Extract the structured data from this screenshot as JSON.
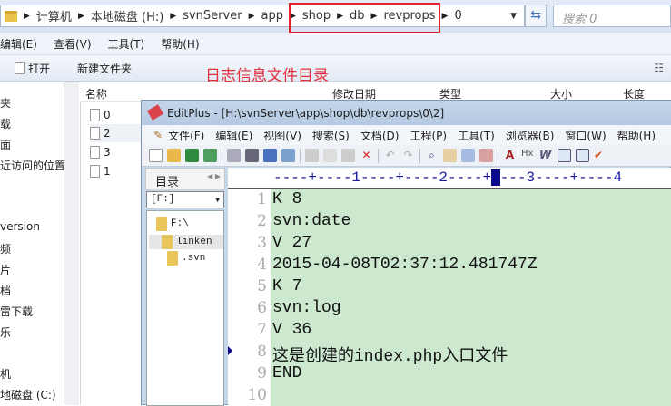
{
  "explorer": {
    "breadcrumb": [
      "计算机",
      "本地磁盘 (H:)",
      "svnServer",
      "app",
      "shop",
      "db",
      "revprops",
      "0"
    ],
    "search_placeholder": "搜索 0",
    "menu": [
      "编辑(E)",
      "查看(V)",
      "工具(T)",
      "帮助(H)"
    ],
    "commands": {
      "open": "打开",
      "new_folder": "新建文件夹"
    },
    "annotation": "日志信息文件目录",
    "annotation_color": "#e0303a",
    "nav_items": [
      "夹",
      "载",
      "面",
      "近访问的位置",
      "version",
      "频",
      "片",
      "档",
      "雷下载",
      "乐",
      "机",
      "地磁盘 (C:)"
    ],
    "columns": [
      "名称",
      "修改日期",
      "类型",
      "大小",
      "长度"
    ],
    "files": [
      "0",
      "2",
      "3",
      "1"
    ],
    "selected_file": "2"
  },
  "editplus": {
    "title": "EditPlus - [H:\\svnServer\\app\\shop\\db\\revprops\\0\\2]",
    "menu": [
      "文件(F)",
      "编辑(E)",
      "视图(V)",
      "搜索(S)",
      "文档(D)",
      "工程(P)",
      "工具(T)",
      "浏览器(B)",
      "窗口(W)",
      "帮助(H)"
    ],
    "dir_tab": "目录",
    "drive": "[F:]",
    "tree": [
      "F:\\",
      "linken",
      ".svn"
    ],
    "ruler": "----+----1----+----2----+",
    "ruler_tail": "---3----+----4",
    "lines": [
      "K 8",
      "svn:date",
      "V 27",
      "2015-04-08T02:37:12.481747Z",
      "K 7",
      "svn:log",
      "V 36",
      "这是创建的index.php入口文件",
      "END",
      ""
    ],
    "line_numbers": [
      "1",
      "2",
      "3",
      "4",
      "5",
      "6",
      "7",
      "8",
      "9",
      "10"
    ],
    "current_line": "8",
    "editor_bg": "#cce8cf"
  }
}
